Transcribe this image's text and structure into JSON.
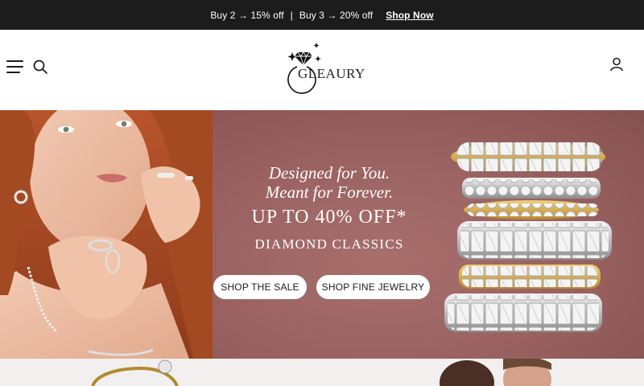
{
  "promo": {
    "deal1": "Buy 2 → 15% off",
    "separator": "|",
    "deal2": "Buy 3 → 20% off",
    "cta": "Shop Now"
  },
  "header": {
    "brand": "GLEAURY",
    "menu_icon": "hamburger-icon",
    "search_icon": "search-icon",
    "account_icon": "user-icon"
  },
  "hero": {
    "tagline_1": "Designed for You.",
    "tagline_2": "Meant for Forever.",
    "offer": "UP TO 40% OFF*",
    "subtitle": "DIAMOND CLASSICS",
    "button_sale": "SHOP THE SALE",
    "button_fine": "SHOP FINE JEWELRY",
    "background_color": "#986160"
  },
  "colors": {
    "promo_bg": "#1c1c1c",
    "accent_gold": "#c9a24a"
  }
}
